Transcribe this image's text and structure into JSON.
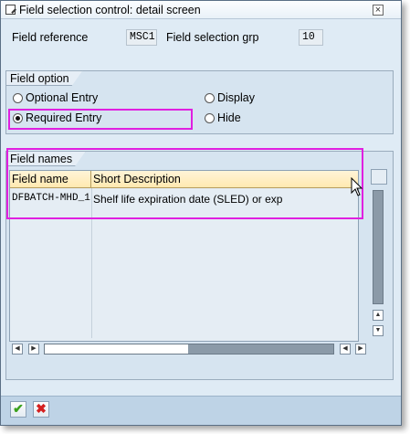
{
  "window": {
    "title": "Field selection control: detail screen",
    "close_symbol": "×"
  },
  "header": {
    "field_reference_label": "Field reference",
    "field_reference_value": "MSC1",
    "field_selection_group_label": "Field selection grp",
    "field_selection_group_value": "10"
  },
  "field_option": {
    "title": "Field option",
    "options": [
      {
        "label": "Optional Entry",
        "selected": false
      },
      {
        "label": "Required Entry",
        "selected": true
      },
      {
        "label": "Display",
        "selected": false
      },
      {
        "label": "Hide",
        "selected": false
      }
    ]
  },
  "field_names": {
    "title": "Field names",
    "columns": [
      "Field name",
      "Short Description"
    ],
    "rows": [
      [
        "DFBATCH-MHD_1",
        "Shelf life expiration date (SLED) or exp"
      ]
    ]
  },
  "scroll": {
    "left_arrow": "◀",
    "right_arrow": "▶",
    "up_arrow": "▲",
    "down_arrow": "▼"
  },
  "footer": {
    "ok_symbol": "✔",
    "cancel_symbol": "✖"
  },
  "colors": {
    "highlight": "#e020e0",
    "dialog_background": "#dfebf5",
    "header_row": "#ffe9b0"
  }
}
